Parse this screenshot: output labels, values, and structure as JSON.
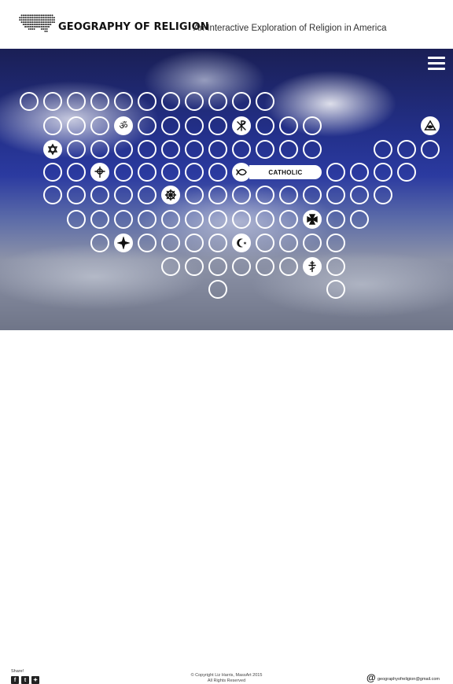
{
  "header": {
    "title": "GEOGRAPHY OF RELIGION",
    "subtitle": "An Interactive Exploration of Religion in America",
    "logo_icon": "usa-dot-map-icon"
  },
  "hero": {
    "menu_icon": "hamburger-menu-icon",
    "active_label": "CATHOLIC"
  },
  "footer": {
    "share_label": "Share!",
    "social": [
      "facebook-icon",
      "tumblr-icon",
      "twitter-icon"
    ],
    "copyright_line1": "© Copyright Liz Harris, MassArt 2015",
    "copyright_line2": "All Rights Reserved",
    "contact_symbol": "@",
    "contact_email": "geographyofreligion@gmail.com"
  }
}
